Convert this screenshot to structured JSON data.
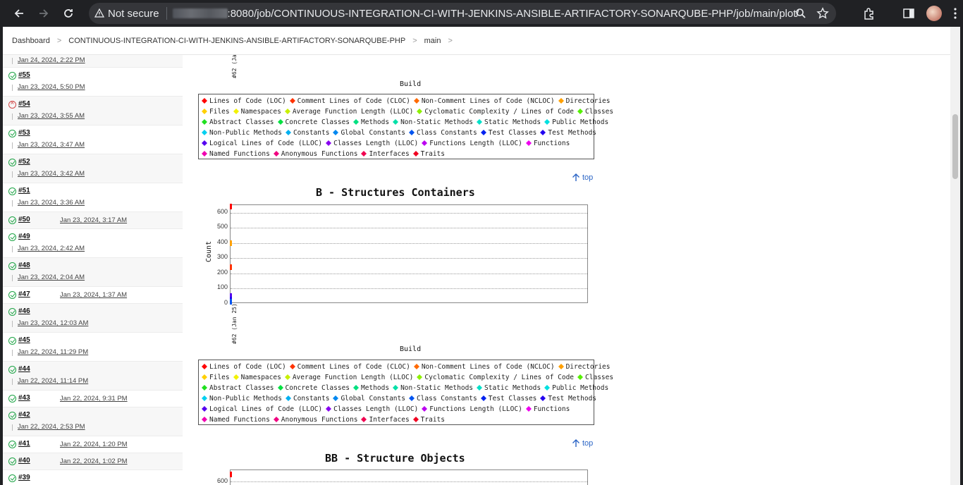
{
  "browser": {
    "security_label": "Not secure",
    "url_path": ":8080/job/CONTINUOUS-INTEGRATION-CI-WITH-JENKINS-ANSIBLE-ARTIFACTORY-SONARQUBE-PHP/job/main/plot/"
  },
  "breadcrumb": {
    "items": [
      "Dashboard",
      "CONTINUOUS-INTEGRATION-CI-WITH-JENKINS-ANSIBLE-ARTIFACTORY-SONARQUBE-PHP",
      "main"
    ]
  },
  "builds": [
    {
      "num": "",
      "date": "Jan 24, 2024, 2:22 PM",
      "status": "success"
    },
    {
      "num": "#55",
      "date": "Jan 23, 2024, 5:50 PM",
      "status": "success"
    },
    {
      "num": "#54",
      "date": "Jan 23, 2024, 3:55 AM",
      "status": "failed"
    },
    {
      "num": "#53",
      "date": "Jan 23, 2024, 3:47 AM",
      "status": "success"
    },
    {
      "num": "#52",
      "date": "Jan 23, 2024, 3:42 AM",
      "status": "success"
    },
    {
      "num": "#51",
      "date": "Jan 23, 2024, 3:36 AM",
      "status": "success"
    },
    {
      "num": "#50",
      "date": "Jan 23, 2024, 3:17 AM",
      "status": "success"
    },
    {
      "num": "#49",
      "date": "Jan 23, 2024, 2:42 AM",
      "status": "success"
    },
    {
      "num": "#48",
      "date": "Jan 23, 2024, 2:04 AM",
      "status": "success"
    },
    {
      "num": "#47",
      "date": "Jan 23, 2024, 1:37 AM",
      "status": "success"
    },
    {
      "num": "#46",
      "date": "Jan 23, 2024, 12:03 AM",
      "status": "success"
    },
    {
      "num": "#45",
      "date": "Jan 22, 2024, 11:29 PM",
      "status": "success"
    },
    {
      "num": "#44",
      "date": "Jan 22, 2024, 11:14 PM",
      "status": "success"
    },
    {
      "num": "#43",
      "date": "Jan 22, 2024, 9:31 PM",
      "status": "success"
    },
    {
      "num": "#42",
      "date": "Jan 22, 2024, 2:53 PM",
      "status": "success"
    },
    {
      "num": "#41",
      "date": "Jan 22, 2024, 1:20 PM",
      "status": "success"
    },
    {
      "num": "#40",
      "date": "Jan 22, 2024, 1:02 PM",
      "status": "success"
    },
    {
      "num": "#39",
      "date": "",
      "status": "success"
    }
  ],
  "legend_items": [
    {
      "label": "Lines of Code (LOC)",
      "color": "#ff0000"
    },
    {
      "label": "Comment Lines of Code (CLOC)",
      "color": "#ff3300"
    },
    {
      "label": "Non-Comment Lines of Code (NCLOC)",
      "color": "#ff6a00"
    },
    {
      "label": "Directories",
      "color": "#ffa000"
    },
    {
      "label": "Files",
      "color": "#ffd000"
    },
    {
      "label": "Namespaces",
      "color": "#f2f200"
    },
    {
      "label": "Average Function Length (LLOC)",
      "color": "#c8f000"
    },
    {
      "label": "Cyclomatic Complexity / Lines of Code",
      "color": "#8df000"
    },
    {
      "label": "Classes",
      "color": "#55f000"
    },
    {
      "label": "Abstract Classes",
      "color": "#20e020"
    },
    {
      "label": "Concrete Classes",
      "color": "#00e040"
    },
    {
      "label": "Methods",
      "color": "#00e080"
    },
    {
      "label": "Non-Static Methods",
      "color": "#00e0a8"
    },
    {
      "label": "Static Methods",
      "color": "#00e0c8"
    },
    {
      "label": "Public Methods",
      "color": "#00e0e0"
    },
    {
      "label": "Non-Public Methods",
      "color": "#00d0f0"
    },
    {
      "label": "Constants",
      "color": "#00b0f0"
    },
    {
      "label": "Global Constants",
      "color": "#0088f0"
    },
    {
      "label": "Class Constants",
      "color": "#0055f0"
    },
    {
      "label": "Test Classes",
      "color": "#0022f0"
    },
    {
      "label": "Test Methods",
      "color": "#2200f0"
    },
    {
      "label": "Logical Lines of Code (LLOC)",
      "color": "#5500f0"
    },
    {
      "label": "Classes Length (LLOC)",
      "color": "#8800f0"
    },
    {
      "label": "Functions Length (LLOC)",
      "color": "#bb00f0"
    },
    {
      "label": "Functions",
      "color": "#ee00ee"
    },
    {
      "label": "Named Functions",
      "color": "#f000b0"
    },
    {
      "label": "Anonymous Functions",
      "color": "#f00080"
    },
    {
      "label": "Interfaces",
      "color": "#f00050"
    },
    {
      "label": "Traits",
      "color": "#f00020"
    }
  ],
  "legend_rows": [
    [
      0,
      1,
      2,
      3
    ],
    [
      4,
      5,
      6,
      7,
      8
    ],
    [
      9,
      10,
      11,
      12,
      13,
      14
    ],
    [
      15,
      16,
      17,
      18,
      19,
      20
    ],
    [
      21,
      22,
      23,
      24
    ],
    [
      25,
      26,
      27,
      28
    ]
  ],
  "plot_common": {
    "xlabel": "Build",
    "ylabel": "Count",
    "x_tick": "#62 (Jan 25)",
    "top_link": "top"
  },
  "chart_data": [
    {
      "type": "line",
      "title": "B - Structures Containers",
      "xlabel": "Build",
      "ylabel": "Count",
      "categories": [
        "#62 (Jan 25)"
      ],
      "yticks": [
        0,
        100,
        200,
        300,
        400,
        500,
        600
      ],
      "ylim": [
        0,
        650
      ],
      "grid": true,
      "legend_position": "below",
      "points": [
        {
          "value": 640,
          "color": "#ff0000"
        },
        {
          "value": 400,
          "color": "#ffa000"
        },
        {
          "value": 240,
          "color": "#ff3300"
        },
        {
          "value": 50,
          "color": "#5500f0"
        },
        {
          "value": 30,
          "color": "#2200f0"
        },
        {
          "value": 15,
          "color": "#0055f0"
        }
      ]
    },
    {
      "type": "line",
      "title": "BB - Structure Objects",
      "xlabel": "Build",
      "ylabel": "Count",
      "categories": [
        "#62 (Jan 25)"
      ],
      "yticks": [
        600
      ],
      "grid": true,
      "points": [
        {
          "value": 640,
          "color": "#ff0000"
        }
      ]
    }
  ],
  "scroll": {
    "thumb": 0.14
  }
}
